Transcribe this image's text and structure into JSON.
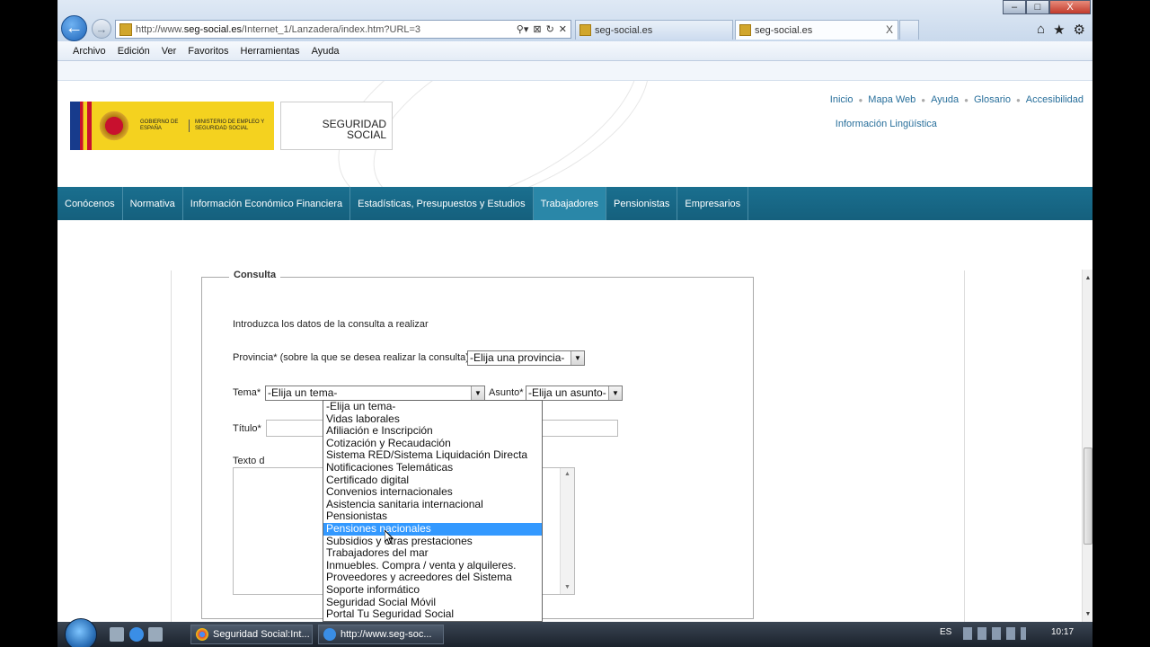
{
  "browser": {
    "address_url_prefix": "http://www.",
    "address_url_domain": "seg-social.es",
    "address_url_path": "/Internet_1/Lanzadera/index.htm?URL=3",
    "tabs": [
      {
        "label": "seg-social.es"
      },
      {
        "label": "seg-social.es"
      }
    ],
    "menu": [
      "Archivo",
      "Edición",
      "Ver",
      "Favoritos",
      "Herramientas",
      "Ayuda"
    ],
    "window_buttons": {
      "minimize": "–",
      "maximize": "□",
      "close": "X"
    },
    "nav_arrows": {
      "back": "←",
      "forward": "→"
    },
    "address_tools": [
      "⚲▾",
      "⊠",
      "↻",
      "✕"
    ],
    "fav_tools": [
      "⌂",
      "★",
      "⚙"
    ]
  },
  "header": {
    "gov_logo_text1": "GOBIERNO DE ESPAÑA",
    "gov_logo_text2": "MINISTERIO DE EMPLEO Y SEGURIDAD SOCIAL",
    "ss_logo_line1": "SEGURIDAD",
    "ss_logo_line2": "SOCIAL",
    "toplinks": [
      "Inicio",
      "Mapa Web",
      "Ayuda",
      "Glosario",
      "Accesibilidad"
    ],
    "toplink_second_row": "Información Lingüística",
    "separator": "●"
  },
  "navbar": [
    "Conócenos",
    "Normativa",
    "Información Económico Financiera",
    "Estadísticas, Presupuestos y Estudios",
    "Trabajadores",
    "Pensionistas",
    "Empresarios"
  ],
  "form": {
    "legend": "Consulta",
    "intro": "Introduzca los datos de la consulta a realizar",
    "provincia_label": "Provincia* (sobre la que se desea realizar la consulta)",
    "provincia_value": "-Elija una provincia-",
    "tema_label": "Tema*",
    "tema_value": "-Elija un tema-",
    "asunto_label": "Asunto*",
    "asunto_value": "-Elija un asunto-",
    "titulo_label": "Título*",
    "texto_label": "Texto d",
    "arrow": "▼"
  },
  "tema_options": [
    "-Elija un tema-",
    "Vidas laborales",
    "Afiliación e Inscripción",
    "Cotización y Recaudación",
    "Sistema RED/Sistema Liquidación Directa",
    "Notificaciones Telemáticas",
    "Certificado digital",
    "Convenios internacionales",
    "Asistencia sanitaria internacional",
    "Pensionistas",
    "Pensiones nacionales",
    "Subsidios y otras prestaciones",
    "Trabajadores del mar",
    "Inmuebles. Compra / venta y alquileres.",
    "Proveedores y acreedores del Sistema",
    "Soporte informático",
    "Seguridad Social Móvil",
    "Portal Tu Seguridad Social"
  ],
  "tema_selected_index": 10,
  "taskbar": {
    "task1": "Seguridad Social:Int...",
    "task2": "http://www.seg-soc...",
    "lang": "ES",
    "time": "10:17"
  }
}
